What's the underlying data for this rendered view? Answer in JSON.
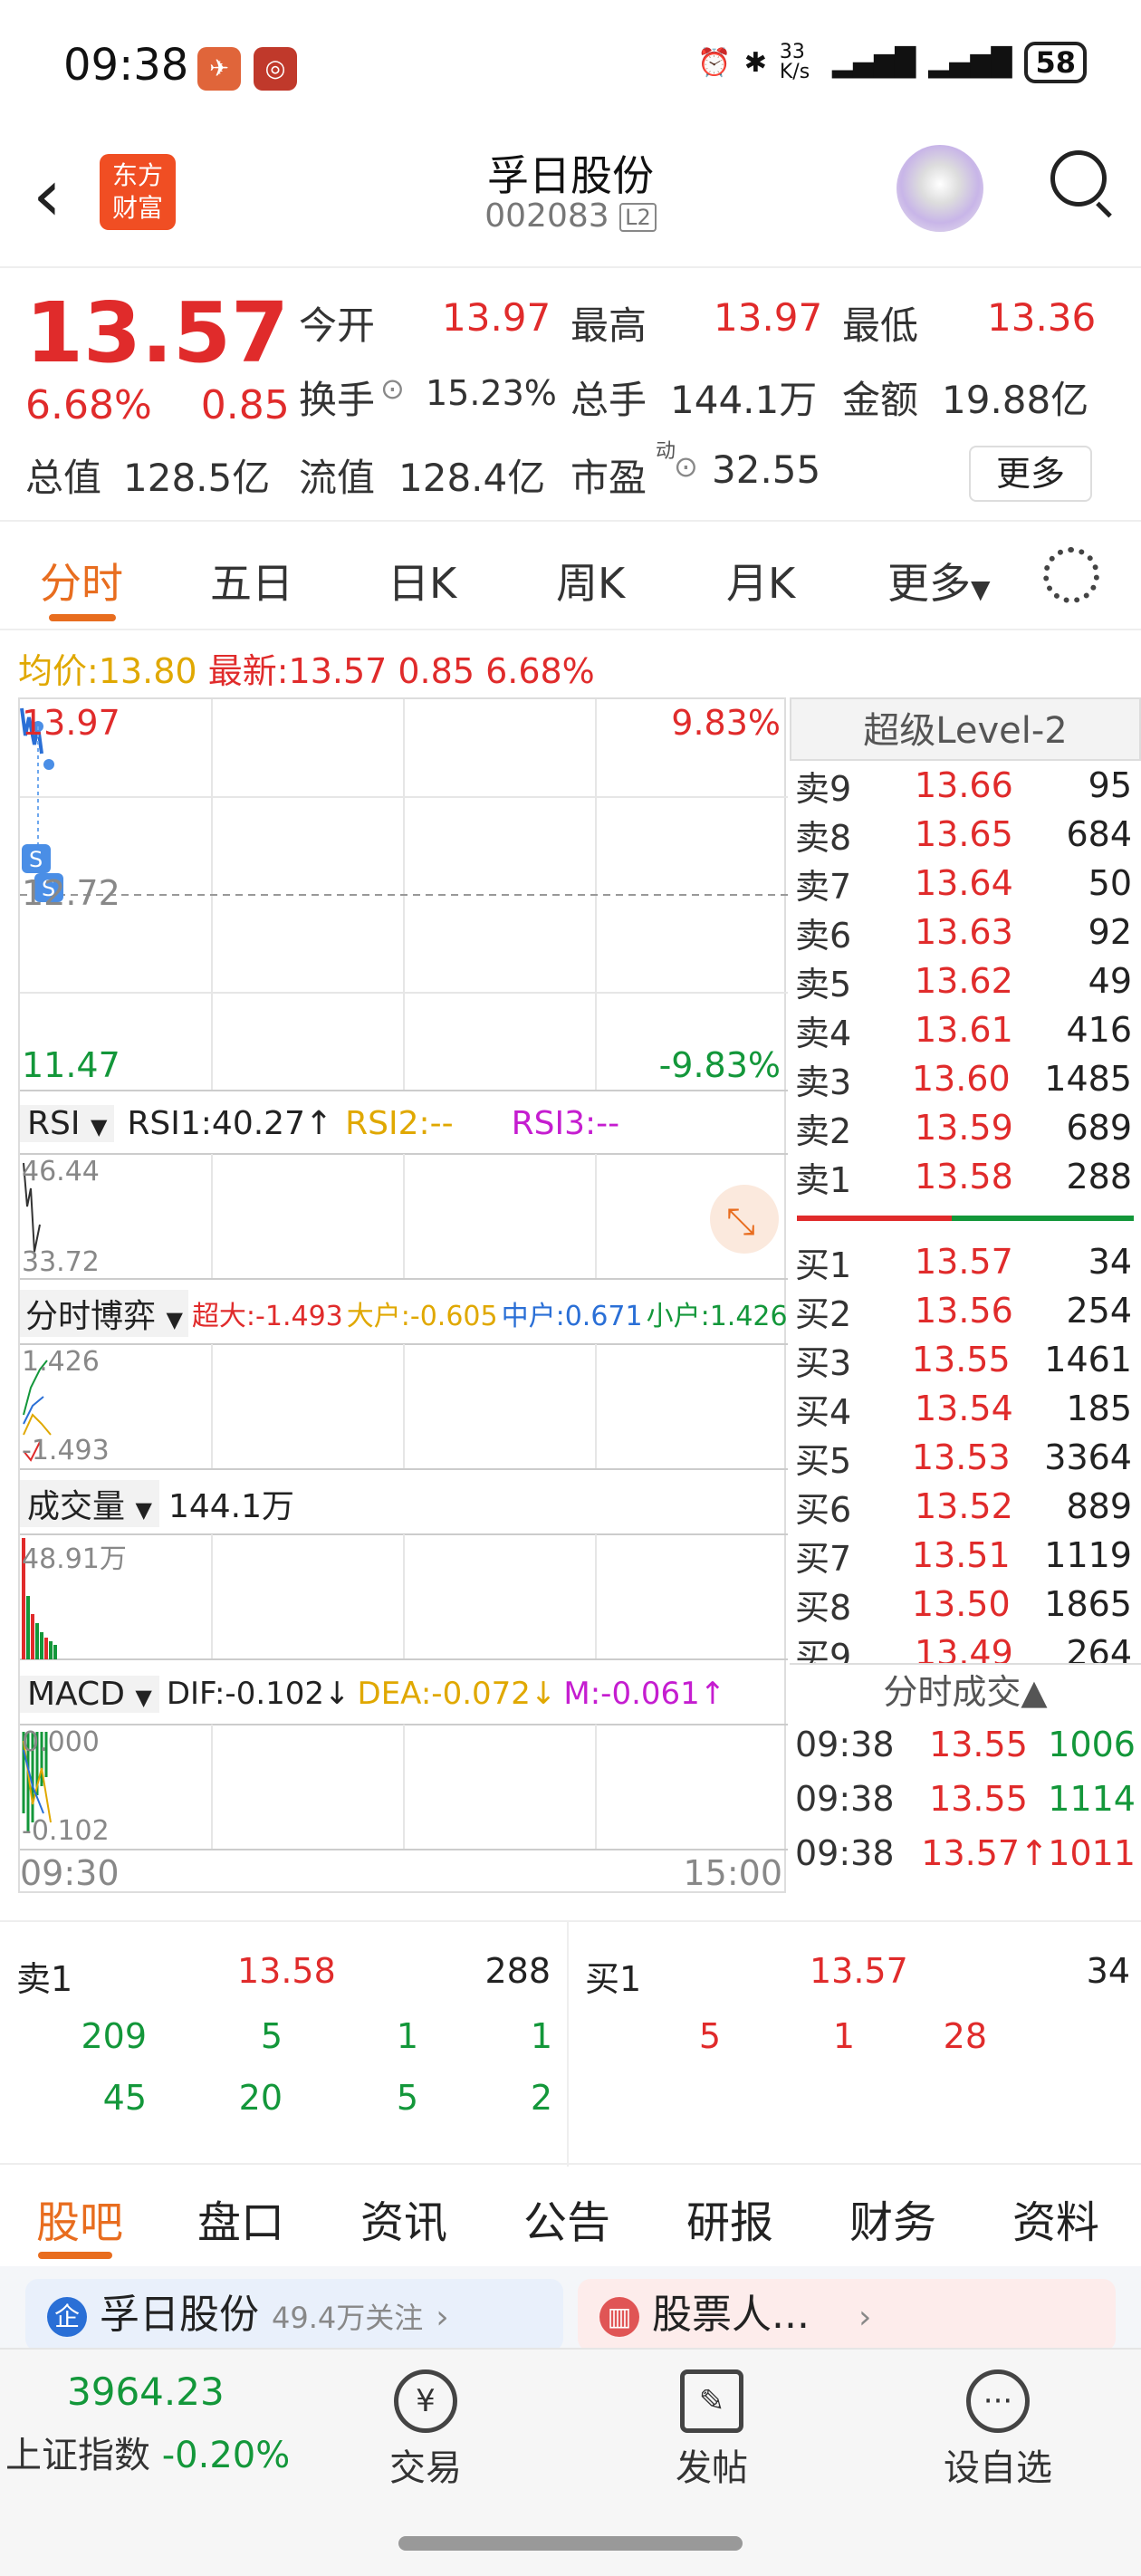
{
  "status": {
    "time": "09:38",
    "net_speed": "33 K/s",
    "battery": "58"
  },
  "header": {
    "logo_line1": "东方",
    "logo_line2": "财富",
    "title": "孚日股份",
    "code": "002083",
    "level": "L2"
  },
  "quote": {
    "price": "13.57",
    "change_pct": "6.68%",
    "change": "0.85",
    "items": [
      {
        "label": "今开",
        "value": "13.97"
      },
      {
        "label": "最高",
        "value": "13.97"
      },
      {
        "label": "最低",
        "value": "13.36"
      },
      {
        "label": "换手",
        "value": "15.23%"
      },
      {
        "label": "总手",
        "value": "144.1万"
      },
      {
        "label": "金额",
        "value": "19.88亿"
      },
      {
        "label": "总值",
        "value": "128.5亿"
      },
      {
        "label": "流值",
        "value": "128.4亿"
      },
      {
        "label": "市盈",
        "value": "32.55"
      }
    ],
    "pe_sup": "动",
    "more": "更多"
  },
  "tabs": [
    "分时",
    "五日",
    "日K",
    "周K",
    "月K",
    "更多"
  ],
  "avgline": {
    "avg_label": "均价:",
    "avg": "13.80",
    "latest_label": "最新:",
    "latest": "13.57 0.85 6.68%"
  },
  "chart": {
    "price_top": "13.97",
    "price_mid": "12.72",
    "price_bot": "11.47",
    "pct_top": "9.83%",
    "pct_bot": "-9.83%",
    "rsi": {
      "name": "RSI",
      "rsi1": "RSI1:40.27↑",
      "rsi2": "RSI2:--",
      "rsi3": "RSI3:--",
      "top": "46.44",
      "bot": "33.72"
    },
    "game": {
      "name": "分时博弈",
      "super": "超大:-1.493",
      "large": "大户:-0.605",
      "mid": "中户:0.671",
      "small": "小户:1.426",
      "top": "1.426",
      "bot": "-1.493"
    },
    "volume": {
      "name": "成交量",
      "value": "144.1万",
      "top": "48.91万"
    },
    "macd": {
      "name": "MACD",
      "dif": "DIF:-0.102↓",
      "dea": "DEA:-0.072↓",
      "m": "M:-0.061↑",
      "top": "0.000",
      "bot": "-0.102"
    },
    "time_start": "09:30",
    "time_end": "15:00"
  },
  "level2": {
    "title": "超级Level-2",
    "sells": [
      {
        "label": "卖9",
        "price": "13.66",
        "vol": "95"
      },
      {
        "label": "卖8",
        "price": "13.65",
        "vol": "684"
      },
      {
        "label": "卖7",
        "price": "13.64",
        "vol": "50"
      },
      {
        "label": "卖6",
        "price": "13.63",
        "vol": "92"
      },
      {
        "label": "卖5",
        "price": "13.62",
        "vol": "49"
      },
      {
        "label": "卖4",
        "price": "13.61",
        "vol": "416"
      },
      {
        "label": "卖3",
        "price": "13.60",
        "vol": "1485"
      },
      {
        "label": "卖2",
        "price": "13.59",
        "vol": "689"
      },
      {
        "label": "卖1",
        "price": "13.58",
        "vol": "288"
      }
    ],
    "buys": [
      {
        "label": "买1",
        "price": "13.57",
        "vol": "34"
      },
      {
        "label": "买2",
        "price": "13.56",
        "vol": "254"
      },
      {
        "label": "买3",
        "price": "13.55",
        "vol": "1461"
      },
      {
        "label": "买4",
        "price": "13.54",
        "vol": "185"
      },
      {
        "label": "买5",
        "price": "13.53",
        "vol": "3364"
      },
      {
        "label": "买6",
        "price": "13.52",
        "vol": "889"
      },
      {
        "label": "买7",
        "price": "13.51",
        "vol": "1119"
      },
      {
        "label": "买8",
        "price": "13.50",
        "vol": "1865"
      },
      {
        "label": "买9",
        "price": "13.49",
        "vol": "264"
      }
    ],
    "ticks_title": "分时成交▲",
    "ticks": [
      {
        "time": "09:38",
        "price": "13.55",
        "vol": "1006",
        "dir": "sell"
      },
      {
        "time": "09:38",
        "price": "13.55",
        "vol": "1114",
        "dir": "sell"
      },
      {
        "time": "09:38",
        "price": "13.57↑",
        "vol": "1011",
        "dir": "buy"
      }
    ]
  },
  "queue": {
    "sell": {
      "label": "卖1",
      "price": "13.58",
      "vol": "288",
      "rows": [
        [
          "209",
          "5",
          "1",
          "1"
        ],
        [
          "45",
          "20",
          "5",
          "2"
        ]
      ]
    },
    "buy": {
      "label": "买1",
      "price": "13.57",
      "vol": "34",
      "rows": [
        [
          "5",
          "1",
          "28"
        ]
      ]
    }
  },
  "bottom_tabs": [
    "股吧",
    "盘口",
    "资讯",
    "公告",
    "研报",
    "财务",
    "资料"
  ],
  "cards": {
    "guba": "孚日股份",
    "guba_follow": "49.4万关注",
    "other": "股票人..."
  },
  "botbar": {
    "index_value": "3964.23",
    "index_name": "上证指数",
    "index_change": "-0.20%",
    "trade": "交易",
    "post": "发帖",
    "watch": "设自选"
  }
}
